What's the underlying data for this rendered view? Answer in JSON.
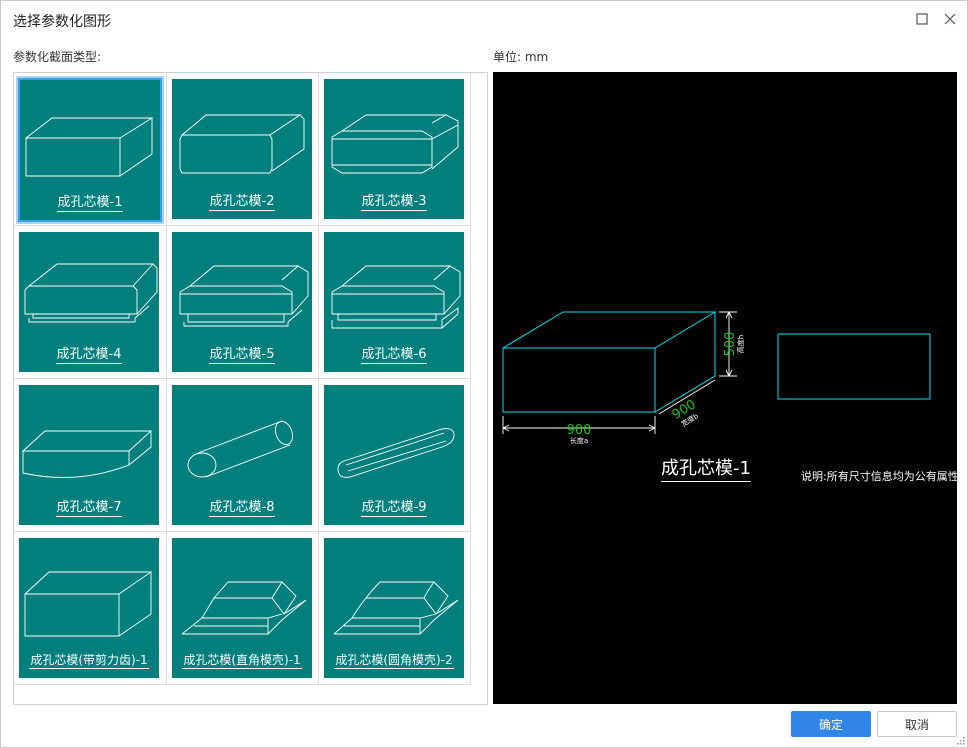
{
  "window": {
    "title": "选择参数化图形"
  },
  "labels": {
    "section": "参数化截面类型:",
    "unit": "单位:   mm"
  },
  "items": [
    {
      "label": "成孔芯模-1",
      "shape": "box"
    },
    {
      "label": "成孔芯模-2",
      "shape": "chamfer"
    },
    {
      "label": "成孔芯模-3",
      "shape": "bevel"
    },
    {
      "label": "成孔芯模-4",
      "shape": "chamfer-base"
    },
    {
      "label": "成孔芯模-5",
      "shape": "bevel-base"
    },
    {
      "label": "成孔芯模-6",
      "shape": "bevel-plate"
    },
    {
      "label": "成孔芯模-7",
      "shape": "arch"
    },
    {
      "label": "成孔芯模-8",
      "shape": "cylinder"
    },
    {
      "label": "成孔芯模-9",
      "shape": "rod"
    },
    {
      "label": "成孔芯模(带剪力齿)-1",
      "shape": "box-tall"
    },
    {
      "label": "成孔芯模(直角模壳)-1",
      "shape": "shell"
    },
    {
      "label": "成孔芯模(圆角模壳)-2",
      "shape": "shell-round"
    }
  ],
  "selected_index": 0,
  "preview": {
    "title": "成孔芯模-1",
    "dim_length": "900",
    "dim_length_label": "长度a",
    "dim_width": "900",
    "dim_width_label": "宽度b",
    "dim_height": "500",
    "dim_height_label": "高度h",
    "note": "说明:所有尺寸信息均为公有属性"
  },
  "buttons": {
    "ok": "确定",
    "cancel": "取消"
  },
  "colors": {
    "tile": "#017f7d",
    "accent": "#2f86e6",
    "selection": "#3da0ea",
    "preview_bg": "#000000",
    "outline": "#00e5ee",
    "dim_text": "#19c319"
  }
}
